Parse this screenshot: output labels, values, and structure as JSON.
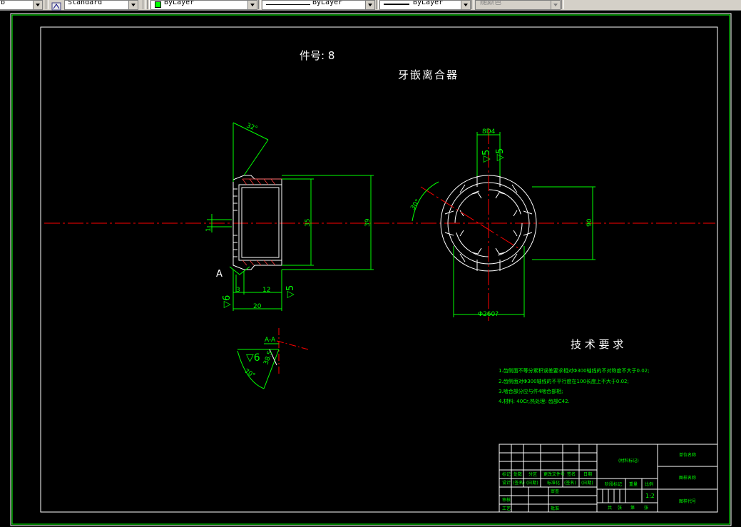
{
  "toolbar": {
    "textstyle": "Standard",
    "color": "ByLayer",
    "linetype": "ByLayer",
    "lineweight": "ByLayer",
    "plotstyle": "随颜色",
    "color_swatch": "#00ff00"
  },
  "drawing": {
    "part_number_label": "件号: 8",
    "part_title": "牙嵌离合器",
    "tech_title": "技 术 要 求",
    "tech_notes": [
      "1.齿侧面不等分累积误差要求相对Φ300轴线的不对称度不大于0.02;",
      "2.齿侧面对Φ300轴线的不平行度在100长度上不大于0.02;",
      "3.啮合部分应与件4啮合部相;",
      "4.材料: 40Cr,热处理: 齿部C42."
    ],
    "section_label": "A-A",
    "view_marker": "A",
    "dims": {
      "angle_top": "32°",
      "left_gap": "1",
      "d35": "35",
      "d39": "39",
      "len12": "12",
      "len3": "3",
      "len20": "20",
      "rough_left": "▽6",
      "rough_bottom": "▽5",
      "tooth_width": "8D4",
      "rough_top": "▽5",
      "angle_30": "30°",
      "d90": "90",
      "dia_bottom": "Φ260?",
      "section_rough": "▽6",
      "section_len": "38.5",
      "section_angle": "70°"
    },
    "title_block": {
      "drawing_label": "(材料标记)",
      "unit_name": "单位名称",
      "drawing_name": "图样名称",
      "drawing_code": "图样代号",
      "scale_value": "1:2",
      "row_labels": [
        "标记",
        "处数",
        "分区",
        "更改文件号",
        "签名",
        "日期"
      ],
      "row2": [
        "设计",
        "(签名)",
        "(日期)",
        "标准化",
        "(签名)",
        "(日期)"
      ],
      "stage_label": "阶段标记",
      "weight_label": "重量",
      "scale_label": "比例",
      "review_label": "审核",
      "process_label": "工艺",
      "approve_label": "批准",
      "check_label": "审查",
      "sheet_total": "共",
      "sheet_of": "张",
      "sheet_no": "第",
      "sheet_unit": "张"
    }
  }
}
